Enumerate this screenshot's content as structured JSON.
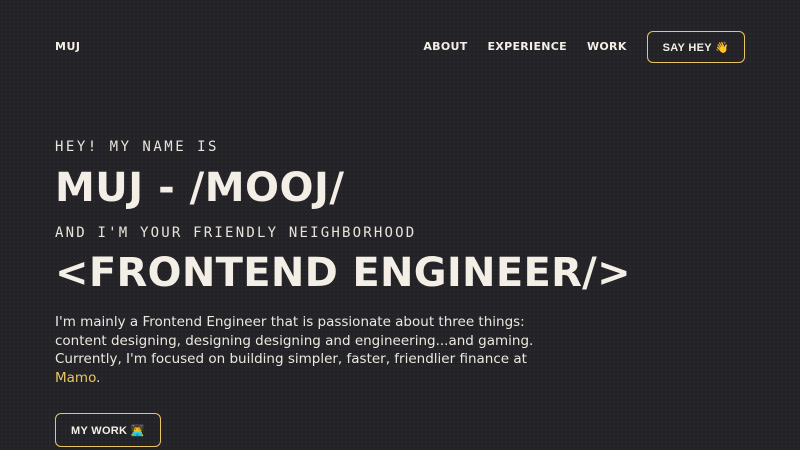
{
  "header": {
    "logo": "MUJ",
    "nav": [
      "ABOUT",
      "EXPERIENCE",
      "WORK"
    ],
    "cta_label": "SAY HEY 👋"
  },
  "hero": {
    "intro": "HEY! MY NAME IS",
    "name": "MUJ - /MOOJ/",
    "tagline": "AND I'M YOUR FRIENDLY NEIGHBORHOOD",
    "role": "<FRONTEND ENGINEER/>",
    "bio_text": "I'm mainly a Frontend Engineer that is passionate about three things: content designing, designing designing and engineering...and gaming. Currently, I'm focused on building simpler, faster, friendlier finance at ",
    "bio_link": "Mamo",
    "bio_end": ".",
    "cta_label": "MY WORK 👨‍💻"
  },
  "colors": {
    "background": "#232227",
    "text": "#f3efe6",
    "accent": "#e8c561"
  }
}
